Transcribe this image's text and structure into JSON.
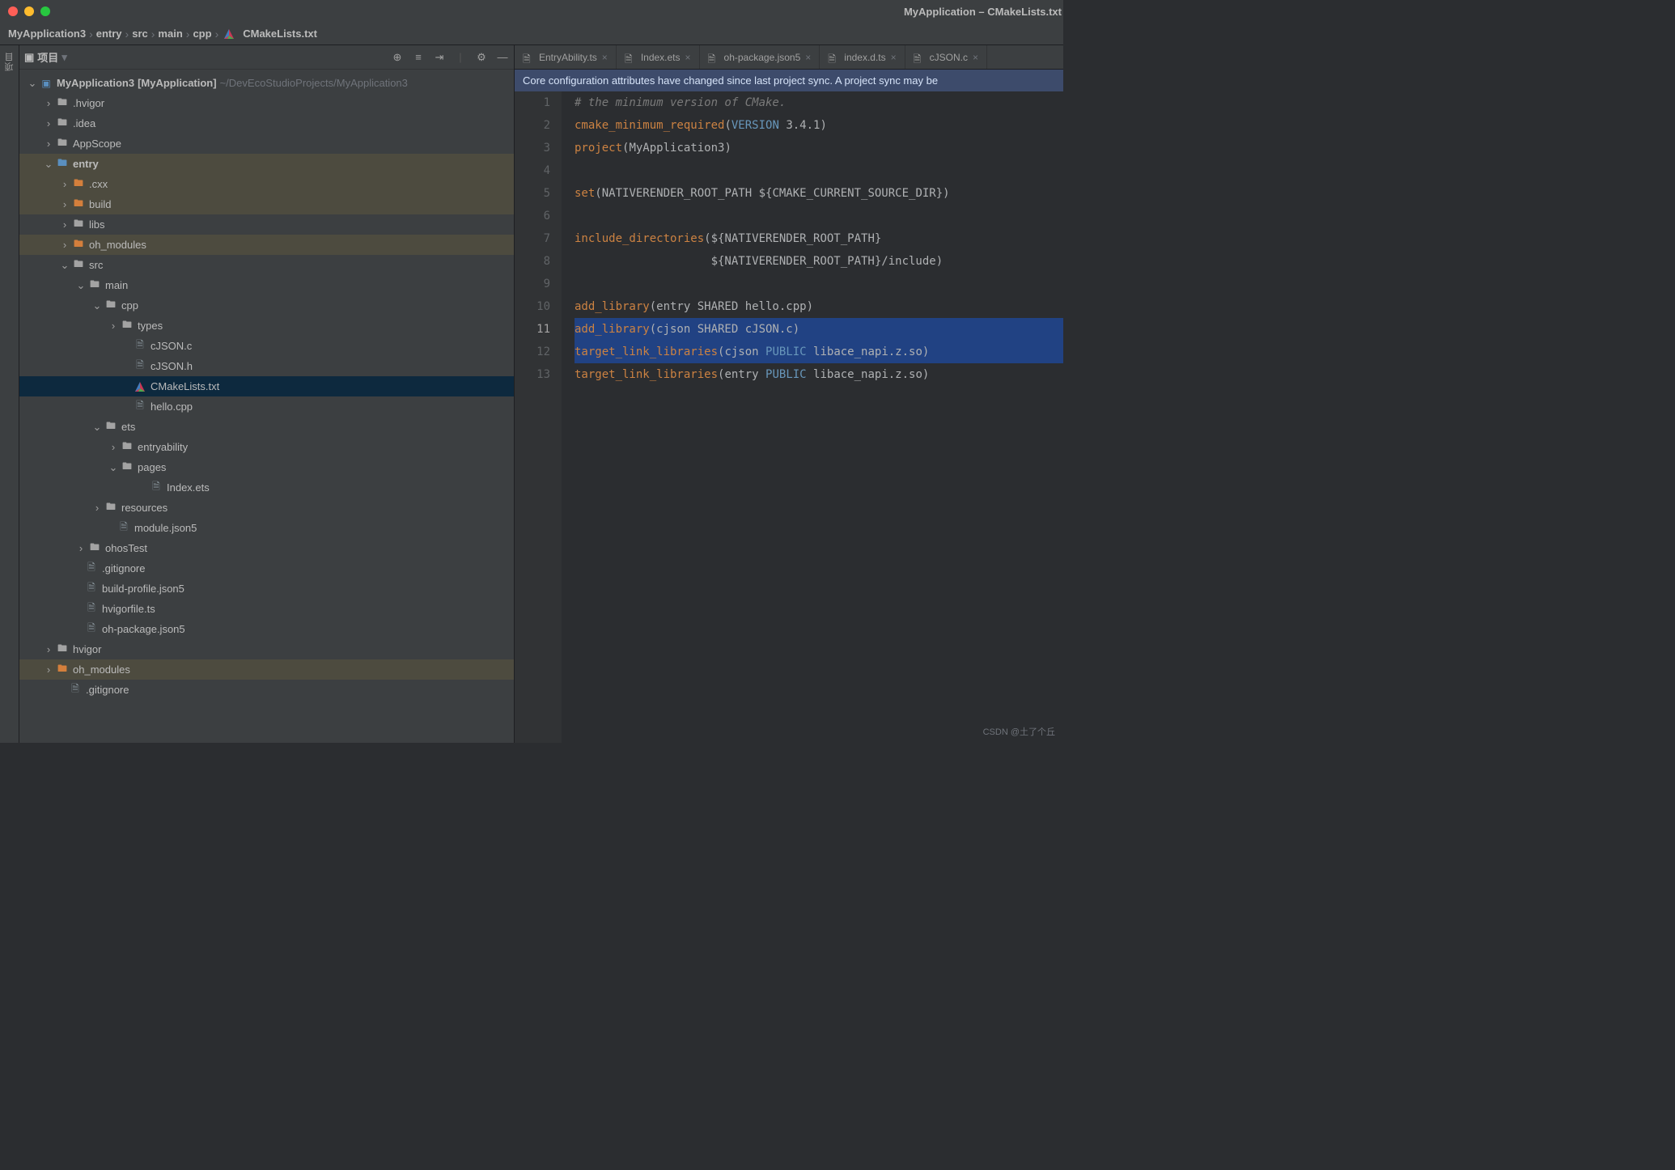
{
  "window": {
    "title": "MyApplication – CMakeLists.txt"
  },
  "breadcrumbs": {
    "root": "MyApplication3",
    "p1": "entry",
    "p2": "src",
    "p3": "main",
    "p4": "cpp",
    "file": "CMakeLists.txt"
  },
  "side_rail": {
    "label": "项目"
  },
  "project_panel": {
    "title": "项目"
  },
  "tree": {
    "root_name": "MyApplication3",
    "root_bracket": "[MyApplication]",
    "root_path": "~/DevEcoStudioProjects/MyApplication3",
    "hvigor": ".hvigor",
    "idea": ".idea",
    "appscope": "AppScope",
    "entry": "entry",
    "cxx": ".cxx",
    "build": "build",
    "libs": "libs",
    "oh_modules": "oh_modules",
    "src": "src",
    "main": "main",
    "cpp": "cpp",
    "types": "types",
    "cjsonc": "cJSON.c",
    "cjsonh": "cJSON.h",
    "cmakelists": "CMakeLists.txt",
    "hellocpp": "hello.cpp",
    "ets": "ets",
    "entryability": "entryability",
    "pages": "pages",
    "indexets": "Index.ets",
    "resources": "resources",
    "modulejson5": "module.json5",
    "ohostest": "ohosTest",
    "gitignore": ".gitignore",
    "buildprofile": "build-profile.json5",
    "hvigorfile": "hvigorfile.ts",
    "ohpackage": "oh-package.json5",
    "hvigor2": "hvigor",
    "oh_modules2": "oh_modules",
    "gitignore2": ".gitignore"
  },
  "tabs": {
    "t1": "EntryAbility.ts",
    "t2": "Index.ets",
    "t3": "oh-package.json5",
    "t4": "index.d.ts",
    "t5": "cJSON.c"
  },
  "notification": "Core configuration attributes have changed since last project sync. A project sync may be",
  "code": {
    "l1": {
      "a": "# the minimum version of CMake."
    },
    "l2": {
      "a": "cmake_minimum_required",
      "b": "(",
      "c": "VERSION",
      "d": " 3.4.1)"
    },
    "l3": {
      "a": "project",
      "b": "(MyApplication3)"
    },
    "l4": {
      "a": ""
    },
    "l5": {
      "a": "set",
      "b": "(NATIVERENDER_ROOT_PATH ${CMAKE_CURRENT_SOURCE_DIR})"
    },
    "l6": {
      "a": ""
    },
    "l7": {
      "a": "include_directories",
      "b": "(${NATIVERENDER_ROOT_PATH}"
    },
    "l8": {
      "a": "                    ${NATIVERENDER_ROOT_PATH}/include)"
    },
    "l9": {
      "a": ""
    },
    "l10": {
      "a": "add_library",
      "b": "(entry SHARED hello.cpp)"
    },
    "l11": {
      "a": "add_library",
      "b": "(cjson SHARED cJSON.c)"
    },
    "l12": {
      "a": "target_link_libraries",
      "b": "(cjson ",
      "c": "PUBLIC",
      "d": " libace_napi.z.so)"
    },
    "l13": {
      "a": "target_link_libraries",
      "b": "(entry ",
      "c": "PUBLIC",
      "d": " libace_napi.z.so)"
    }
  },
  "line_numbers": [
    "1",
    "2",
    "3",
    "4",
    "5",
    "6",
    "7",
    "8",
    "9",
    "10",
    "11",
    "12",
    "13"
  ],
  "watermark": "CSDN @土了个丘"
}
